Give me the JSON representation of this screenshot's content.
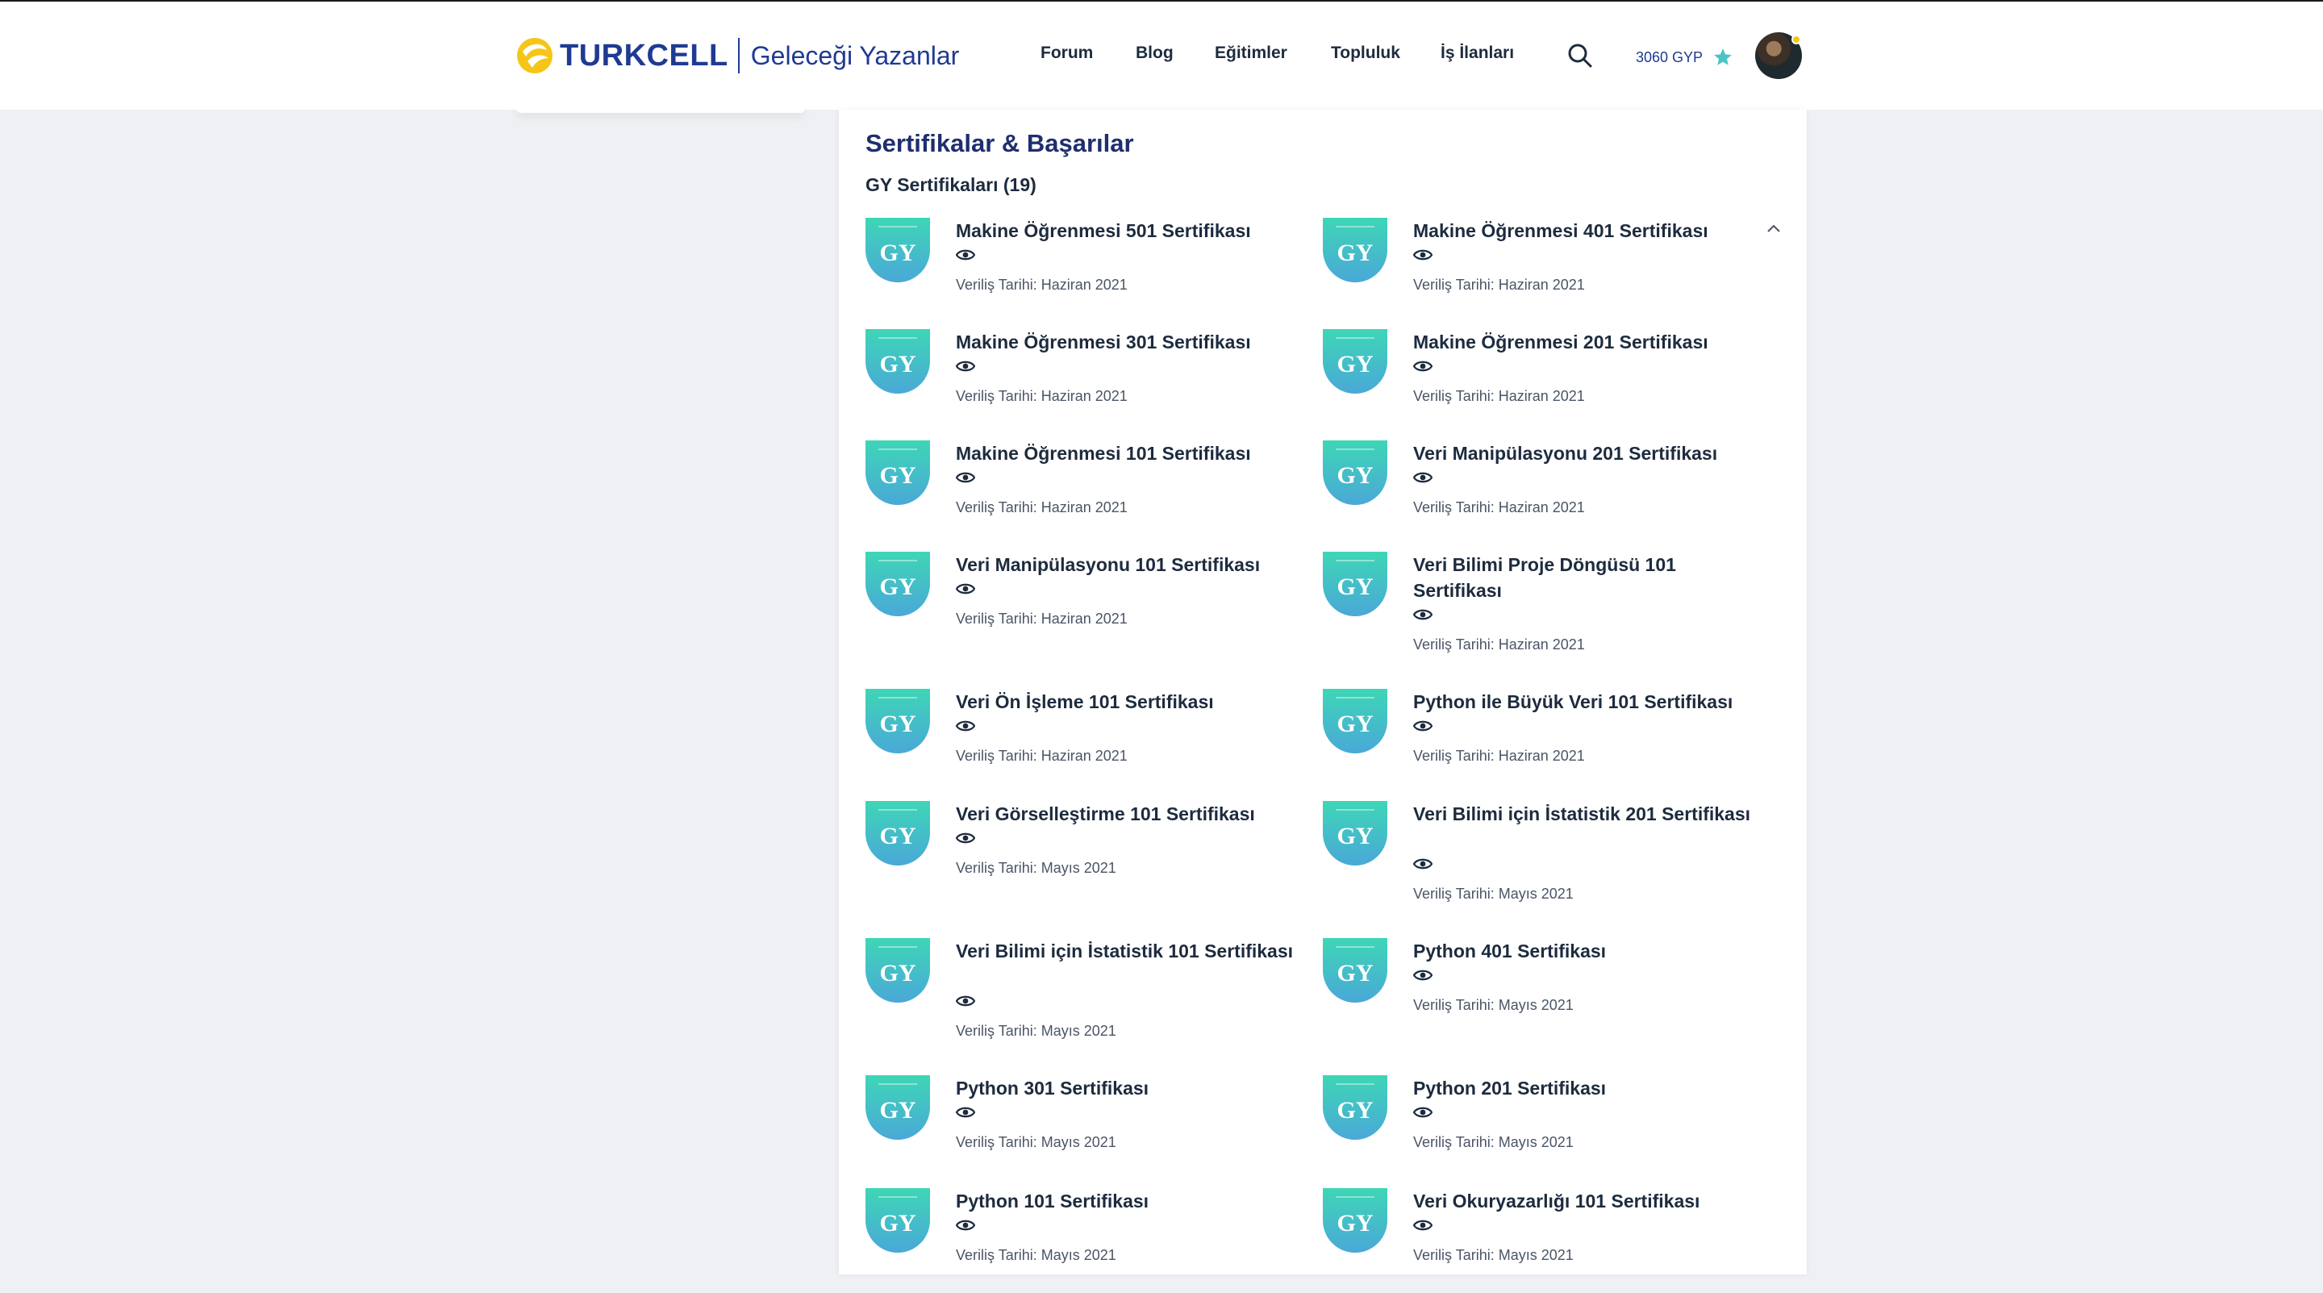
{
  "header": {
    "brand": "TURKCELL",
    "subtitle": "Geleceği Yazanlar",
    "nav": [
      "Forum",
      "Blog",
      "Eğitimler",
      "Topluluk",
      "İş İlanları"
    ],
    "points": "3060 GYP"
  },
  "colors": {
    "brand_blue": "#1f3a93",
    "brand_yellow": "#f5c518",
    "badge_teal": "#4ec3c5"
  },
  "section": {
    "title": "Sertifikalar & Başarılar",
    "subtitle": "GY Sertifikaları (19)"
  },
  "certificates": [
    {
      "badge": "GY",
      "title": "Makine Öğrenmesi 501 Sertifikası",
      "date": "Veriliş Tarihi: Haziran 2021"
    },
    {
      "badge": "GY",
      "title": "Makine Öğrenmesi 401 Sertifikası",
      "date": "Veriliş Tarihi: Haziran 2021"
    },
    {
      "badge": "GY",
      "title": "Makine Öğrenmesi 301 Sertifikası",
      "date": "Veriliş Tarihi: Haziran 2021"
    },
    {
      "badge": "GY",
      "title": "Makine Öğrenmesi 201 Sertifikası",
      "date": "Veriliş Tarihi: Haziran 2021"
    },
    {
      "badge": "GY",
      "title": "Makine Öğrenmesi 101 Sertifikası",
      "date": "Veriliş Tarihi: Haziran 2021"
    },
    {
      "badge": "GY",
      "title": "Veri Manipülasyonu 201 Sertifikası",
      "date": "Veriliş Tarihi: Haziran 2021"
    },
    {
      "badge": "GY",
      "title": "Veri Manipülasyonu 101 Sertifikası",
      "date": "Veriliş Tarihi: Haziran 2021"
    },
    {
      "badge": "GY",
      "title": "Veri Bilimi Proje Döngüsü 101 Sertifikası",
      "date": "Veriliş Tarihi: Haziran 2021"
    },
    {
      "badge": "GY",
      "title": "Veri Ön İşleme 101 Sertifikası",
      "date": "Veriliş Tarihi: Haziran 2021"
    },
    {
      "badge": "GY",
      "title": "Python ile Büyük Veri 101 Sertifikası",
      "date": "Veriliş Tarihi: Haziran 2021"
    },
    {
      "badge": "GY",
      "title": "Veri Görselleştirme 101 Sertifikası",
      "date": "Veriliş Tarihi: Mayıs 2021"
    },
    {
      "badge": "GY",
      "title": "Veri Bilimi için İstatistik 201 Sertifikası",
      "date": "Veriliş Tarihi: Mayıs 2021"
    },
    {
      "badge": "GY",
      "title": "Veri Bilimi için İstatistik 101 Sertifikası",
      "date": "Veriliş Tarihi: Mayıs 2021"
    },
    {
      "badge": "GY",
      "title": "Python 401 Sertifikası",
      "date": "Veriliş Tarihi: Mayıs 2021"
    },
    {
      "badge": "GY",
      "title": "Python 301 Sertifikası",
      "date": "Veriliş Tarihi: Mayıs 2021"
    },
    {
      "badge": "GY",
      "title": "Python 201 Sertifikası",
      "date": "Veriliş Tarihi: Mayıs 2021"
    },
    {
      "badge": "GY",
      "title": "Python 101 Sertifikası",
      "date": "Veriliş Tarihi: Mayıs 2021"
    },
    {
      "badge": "GY",
      "title": "Veri Okuryazarlığı 101 Sertifikası",
      "date": "Veriliş Tarihi: Mayıs 2021"
    }
  ]
}
